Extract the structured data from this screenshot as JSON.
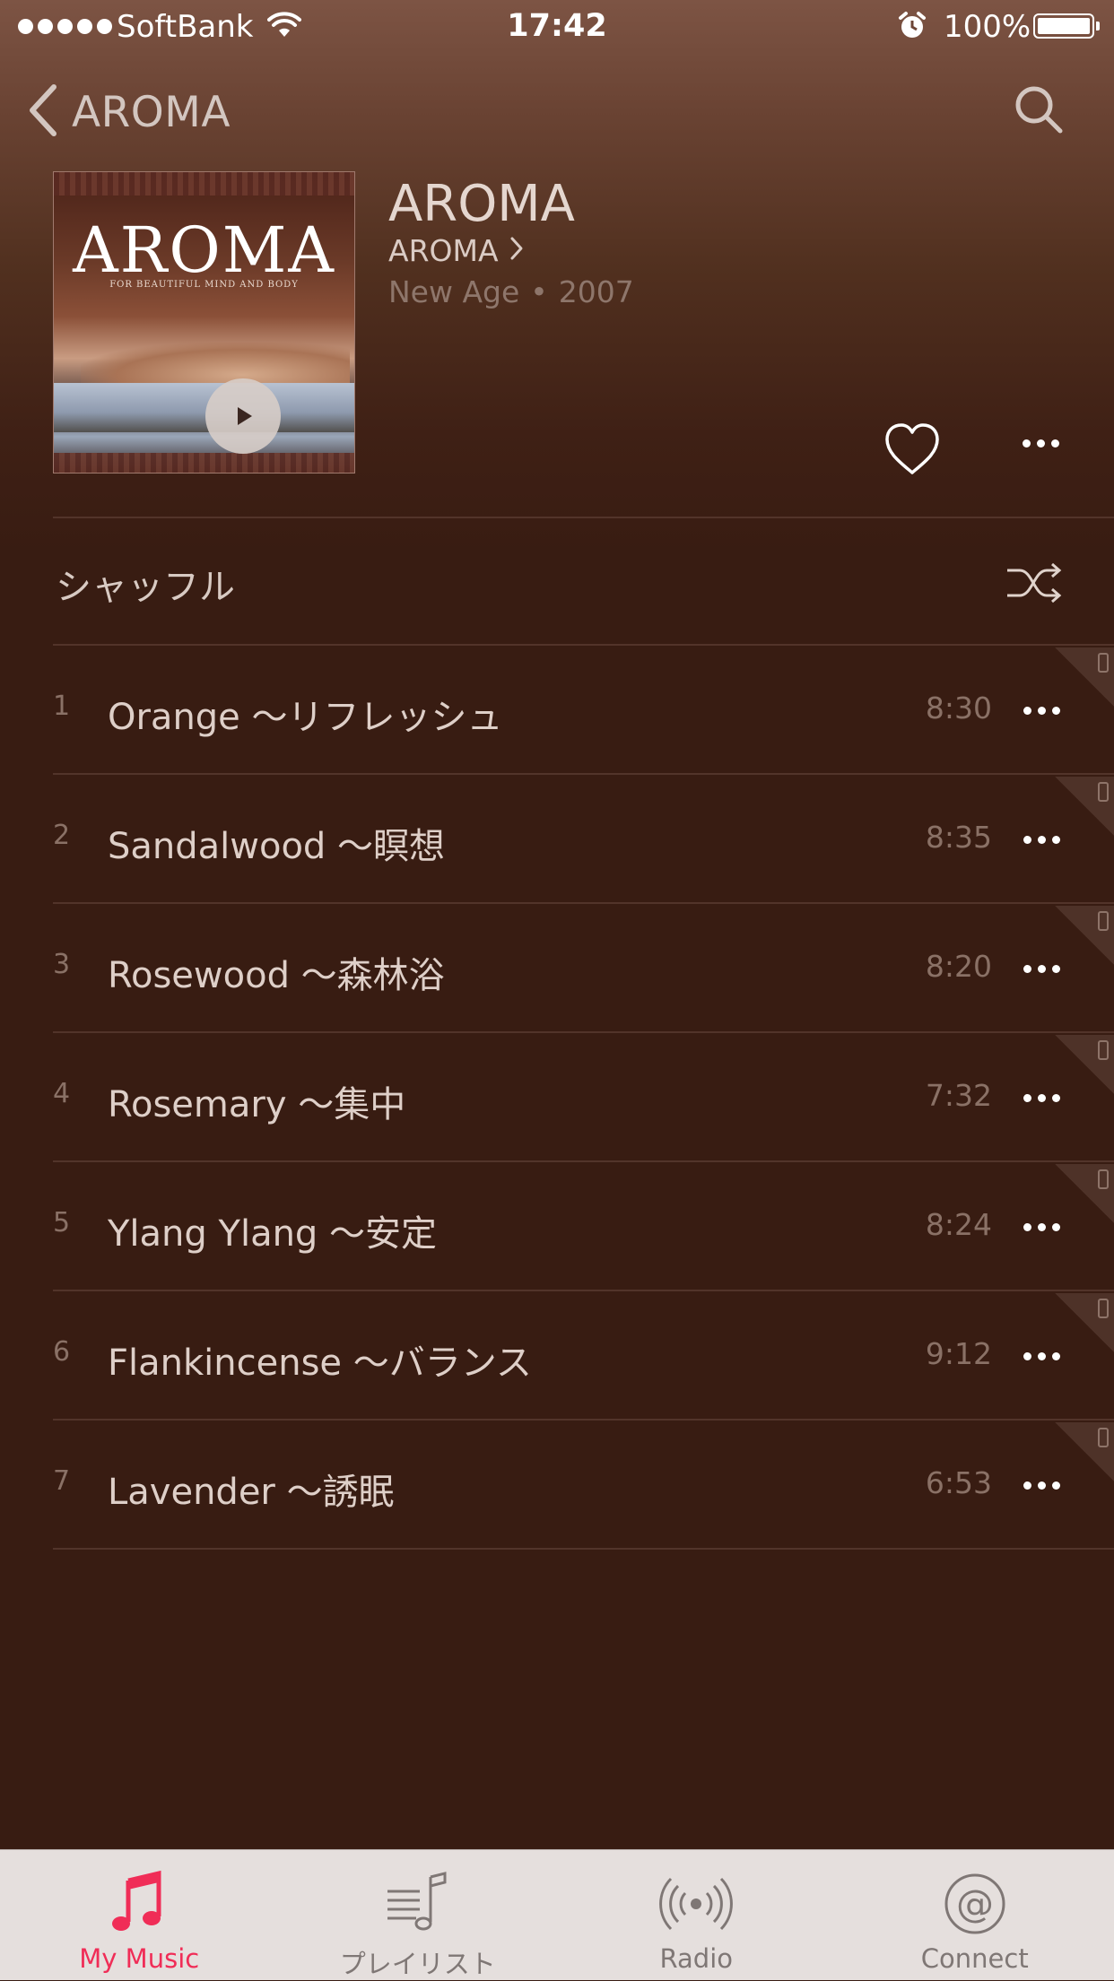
{
  "status_bar": {
    "carrier": "SoftBank",
    "time": "17:42",
    "battery": "100%"
  },
  "nav": {
    "back_label": "AROMA"
  },
  "album": {
    "art_title": "AROMA",
    "art_subtitle": "FOR BEAUTIFUL MIND AND BODY",
    "title": "AROMA",
    "artist": "AROMA",
    "genre": "New Age",
    "separator": "•",
    "year": "2007"
  },
  "shuffle": {
    "label": "シャッフル"
  },
  "tracks": [
    {
      "num": "1",
      "title": "Orange ～リフレッシュ",
      "duration": "8:30"
    },
    {
      "num": "2",
      "title": "Sandalwood ～瞑想",
      "duration": "8:35"
    },
    {
      "num": "3",
      "title": "Rosewood ～森林浴",
      "duration": "8:20"
    },
    {
      "num": "4",
      "title": "Rosemary ～集中",
      "duration": "7:32"
    },
    {
      "num": "5",
      "title": "Ylang Ylang ～安定",
      "duration": "8:24"
    },
    {
      "num": "6",
      "title": "Flankincense ～バランス",
      "duration": "9:12"
    },
    {
      "num": "7",
      "title": "Lavender ～誘眠",
      "duration": "6:53"
    }
  ],
  "tab_bar": {
    "tabs": [
      {
        "label": "My Music",
        "icon": "music-note-icon",
        "active": true
      },
      {
        "label": "プレイリスト",
        "icon": "playlist-icon",
        "active": false
      },
      {
        "label": "Radio",
        "icon": "radio-icon",
        "active": false
      },
      {
        "label": "Connect",
        "icon": "connect-icon",
        "active": false
      }
    ]
  },
  "colors": {
    "background": "#381c12",
    "accent": "#f02d57",
    "tab_bar": "#e5dfdd"
  }
}
